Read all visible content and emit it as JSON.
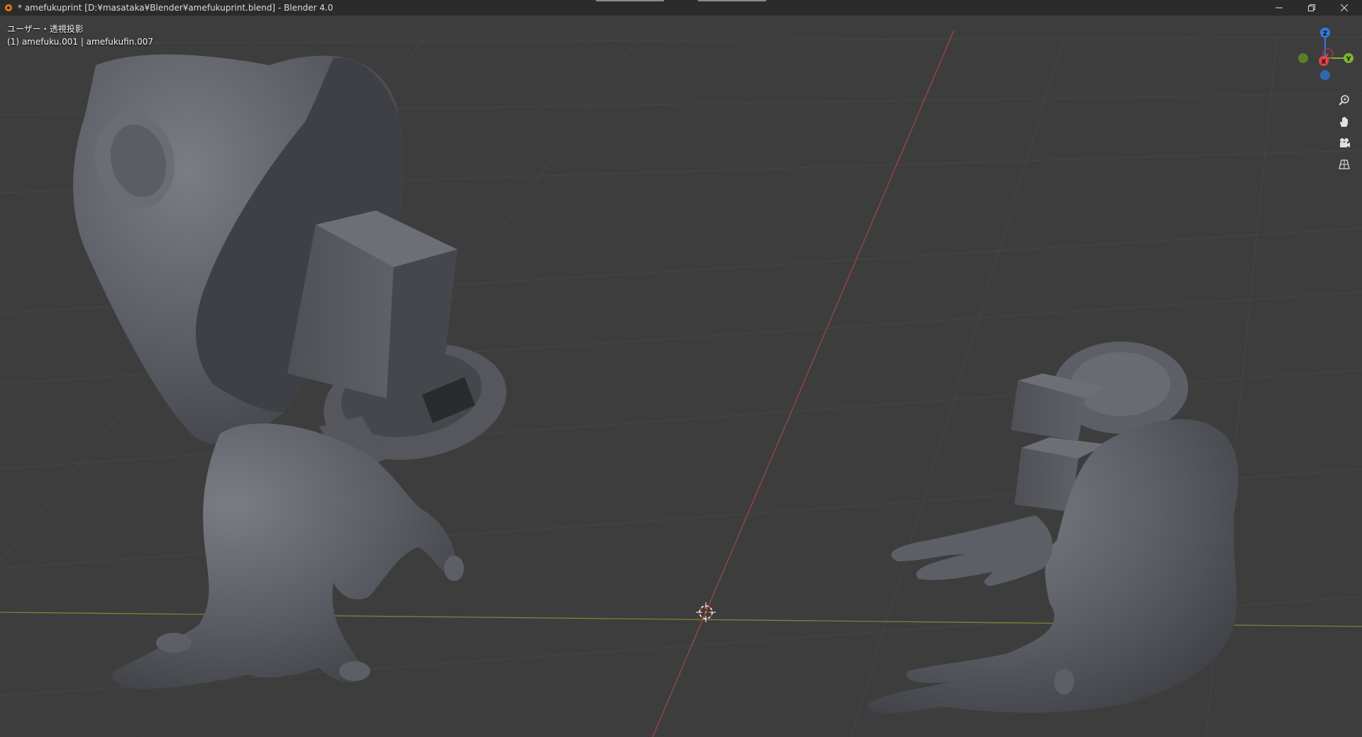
{
  "window": {
    "title": "* amefukuprint [D:¥masataka¥Blender¥amefukuprint.blend] - Blender 4.0"
  },
  "viewport": {
    "view_label": "ユーザー・透視投影",
    "object_label": "(1) amefuku.001 | amefukufin.007"
  },
  "gizmo": {
    "axis_x": "X",
    "axis_y": "Y",
    "axis_z": "Z",
    "colors": {
      "x": "#e8414b",
      "y": "#7fb52b",
      "z": "#2f7ddb"
    }
  },
  "nav_tools": [
    {
      "icon": "zoom-icon"
    },
    {
      "icon": "hand-pan-icon"
    },
    {
      "icon": "camera-icon"
    },
    {
      "icon": "perspective-grid-icon"
    }
  ],
  "colors": {
    "background": "#3d3d3d",
    "grid": "#4a4a4a",
    "x_axis_line": "#a04545",
    "y_axis_line": "#6f8a3a",
    "mesh": "#5c5f66"
  }
}
